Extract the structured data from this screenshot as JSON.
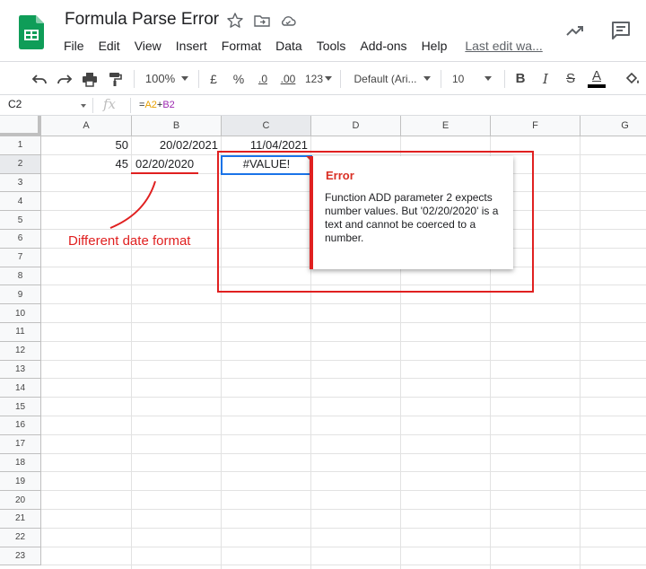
{
  "document": {
    "title": "Formula Parse Error"
  },
  "menu": {
    "items": [
      "File",
      "Edit",
      "View",
      "Insert",
      "Format",
      "Data",
      "Tools",
      "Add-ons",
      "Help"
    ],
    "last_edit": "Last edit wa..."
  },
  "icons": {
    "title_icons": [
      "star-icon",
      "move-to-folder-icon",
      "cloud-saved-icon"
    ],
    "top_right": [
      "activity-trend-icon",
      "comments-icon"
    ],
    "toolbar": [
      "undo-icon",
      "redo-icon",
      "print-icon",
      "paint-format-icon",
      "bold-icon",
      "italic-icon",
      "strikethrough-icon",
      "text-color-icon",
      "fill-color-icon"
    ]
  },
  "toolbar": {
    "zoom": "100%",
    "currency": "£",
    "percent": "%",
    "decrease_decimals": ".0",
    "increase_decimals": ".00",
    "more_formats": "123",
    "font": "Default (Ari...",
    "font_size": "10",
    "bold": "B",
    "italic": "I",
    "strikethrough": "S",
    "text_color": "A"
  },
  "formula_bar": {
    "name_box": "C2",
    "fx": "fx",
    "formula_prefix": "=",
    "ref1": "A2",
    "operator": "+",
    "ref2": "B2"
  },
  "grid": {
    "columns": [
      "A",
      "B",
      "C",
      "D",
      "E",
      "F",
      "G"
    ],
    "selected_column": "C",
    "rows": [
      "1",
      "2",
      "3",
      "4",
      "5",
      "6",
      "7",
      "8",
      "9",
      "10",
      "11",
      "12",
      "13",
      "14",
      "15",
      "16",
      "17",
      "18",
      "19",
      "20",
      "21",
      "22",
      "23"
    ],
    "selected_row": "2",
    "cells": {
      "A1": "50",
      "B1": "20/02/2021",
      "C1": "11/04/2021",
      "A2": "45",
      "B2": "02/20/2020",
      "C2": "#VALUE!"
    }
  },
  "error_popup": {
    "title": "Error",
    "message": "Function ADD parameter 2 expects number values. But '02/20/2020' is a text and cannot be coerced to a number."
  },
  "annotation": {
    "text": "Different date format",
    "color": "#e02020"
  },
  "colors": {
    "accent_blue": "#1a73e8",
    "error_red": "#d93025",
    "sheets_green": "#0f9d58",
    "ref_a": "#e8a000",
    "ref_b": "#9c27b0"
  }
}
